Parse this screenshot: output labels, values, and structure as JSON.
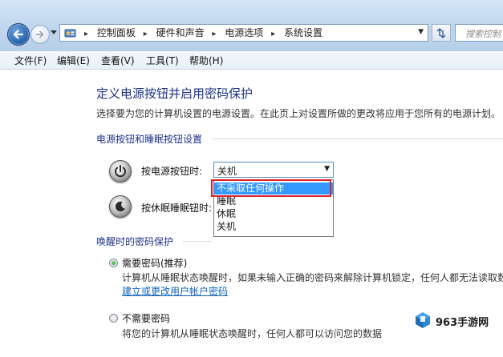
{
  "address_bar": {
    "breadcrumbs": [
      "控制面板",
      "硬件和声音",
      "电源选项",
      "系统设置"
    ]
  },
  "search": {
    "placeholder": "搜索控制"
  },
  "menu": [
    "文件(F)",
    "编辑(E)",
    "查看(V)",
    "工具(T)",
    "帮助(H)"
  ],
  "page": {
    "title": "定义电源按钮并启用密码保护",
    "description": "选择要为您的计算机设置的电源设置。在此页上对设置所做的更改将应用于您所有的电源计划。"
  },
  "buttons_section": {
    "title": "电源按钮和睡眠按钮设置",
    "power_label": "按电源按钮时:",
    "sleep_label": "按休眠睡眠钮时:",
    "select_value": "关机",
    "options": [
      "不采取任何操作",
      "睡眠",
      "休眠",
      "关机"
    ],
    "highlighted_index": 0
  },
  "password_section": {
    "title": "唤醒时的密码保护",
    "require_label": "需要密码(推荐)",
    "require_desc": "计算机从睡眠状态唤醒时，如果未输入正确的密码来解除计算机锁定，任何人都无法读取数",
    "require_link": "建立或更改用户帐户密码",
    "no_require_label": "不需要密码",
    "no_require_desc": "将您的计算机从睡眠状态唤醒时，任何人都可以访问您的数据",
    "selected": "require"
  },
  "watermark": {
    "brand": "963手游网"
  },
  "colors": {
    "accent": "#1e3287",
    "link": "#0f63b8",
    "highlight": "#3399ff",
    "callout": "#e0202a"
  }
}
